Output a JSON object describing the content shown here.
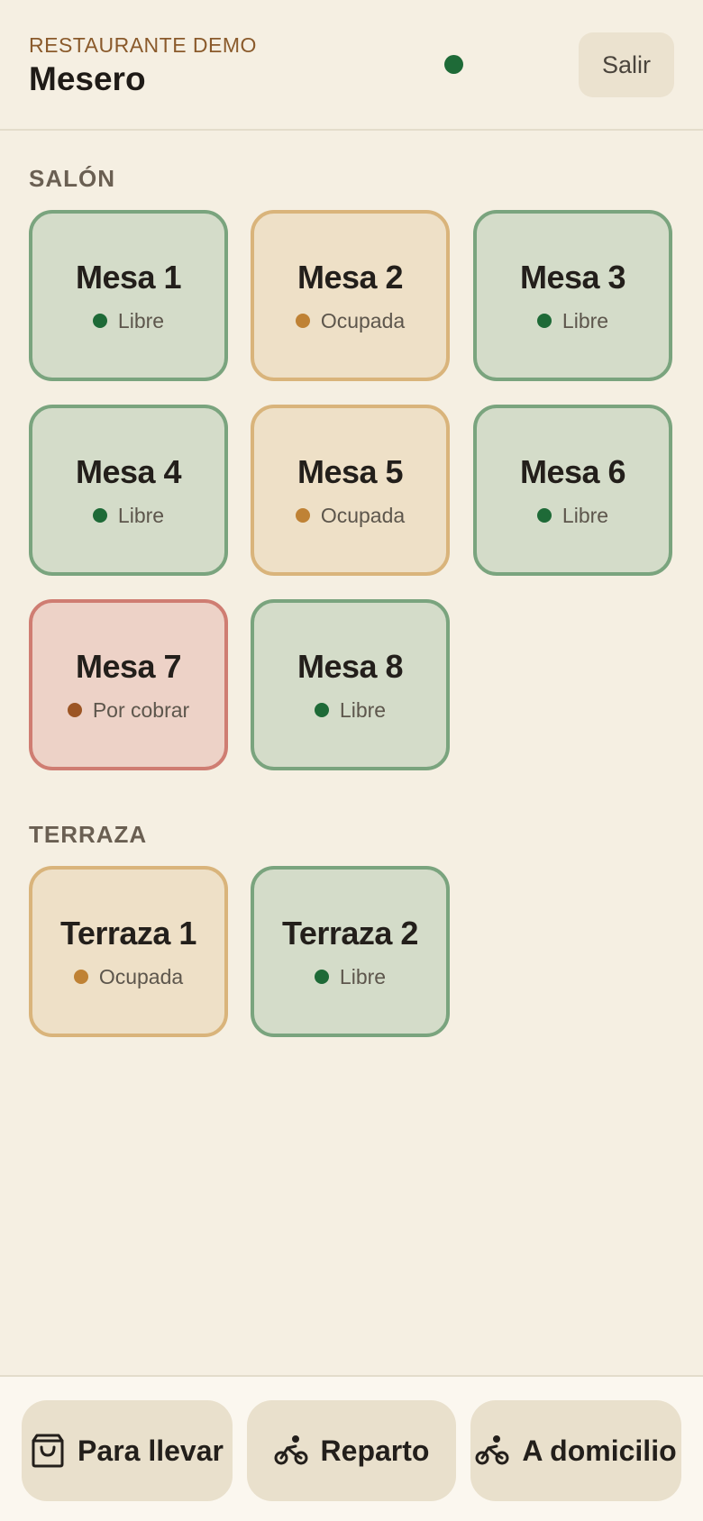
{
  "header": {
    "restaurant": "RESTAURANTE DEMO",
    "role": "Mesero",
    "connection_color": "#1e6a37",
    "logout_label": "Salir"
  },
  "sections": [
    {
      "title": "SALÓN",
      "tables": [
        {
          "name": "Mesa 1",
          "status": "Libre"
        },
        {
          "name": "Mesa 2",
          "status": "Ocupada"
        },
        {
          "name": "Mesa 3",
          "status": "Libre"
        },
        {
          "name": "Mesa 4",
          "status": "Libre"
        },
        {
          "name": "Mesa 5",
          "status": "Ocupada"
        },
        {
          "name": "Mesa 6",
          "status": "Libre"
        },
        {
          "name": "Mesa 7",
          "status": "Por cobrar"
        },
        {
          "name": "Mesa 8",
          "status": "Libre"
        }
      ]
    },
    {
      "title": "TERRAZA",
      "tables": [
        {
          "name": "Terraza 1",
          "status": "Ocupada"
        },
        {
          "name": "Terraza 2",
          "status": "Libre"
        }
      ]
    }
  ],
  "status_colors": {
    "libre": "#1e6a37",
    "ocupada": "#bf8235",
    "por_cobrar": "#9c5524"
  },
  "bottom_nav": [
    {
      "label": "Para llevar",
      "icon": "shopping-bag-icon"
    },
    {
      "label": "Reparto",
      "icon": "bicycle-icon"
    },
    {
      "label": "A domicilio",
      "icon": "bicycle-icon"
    }
  ]
}
